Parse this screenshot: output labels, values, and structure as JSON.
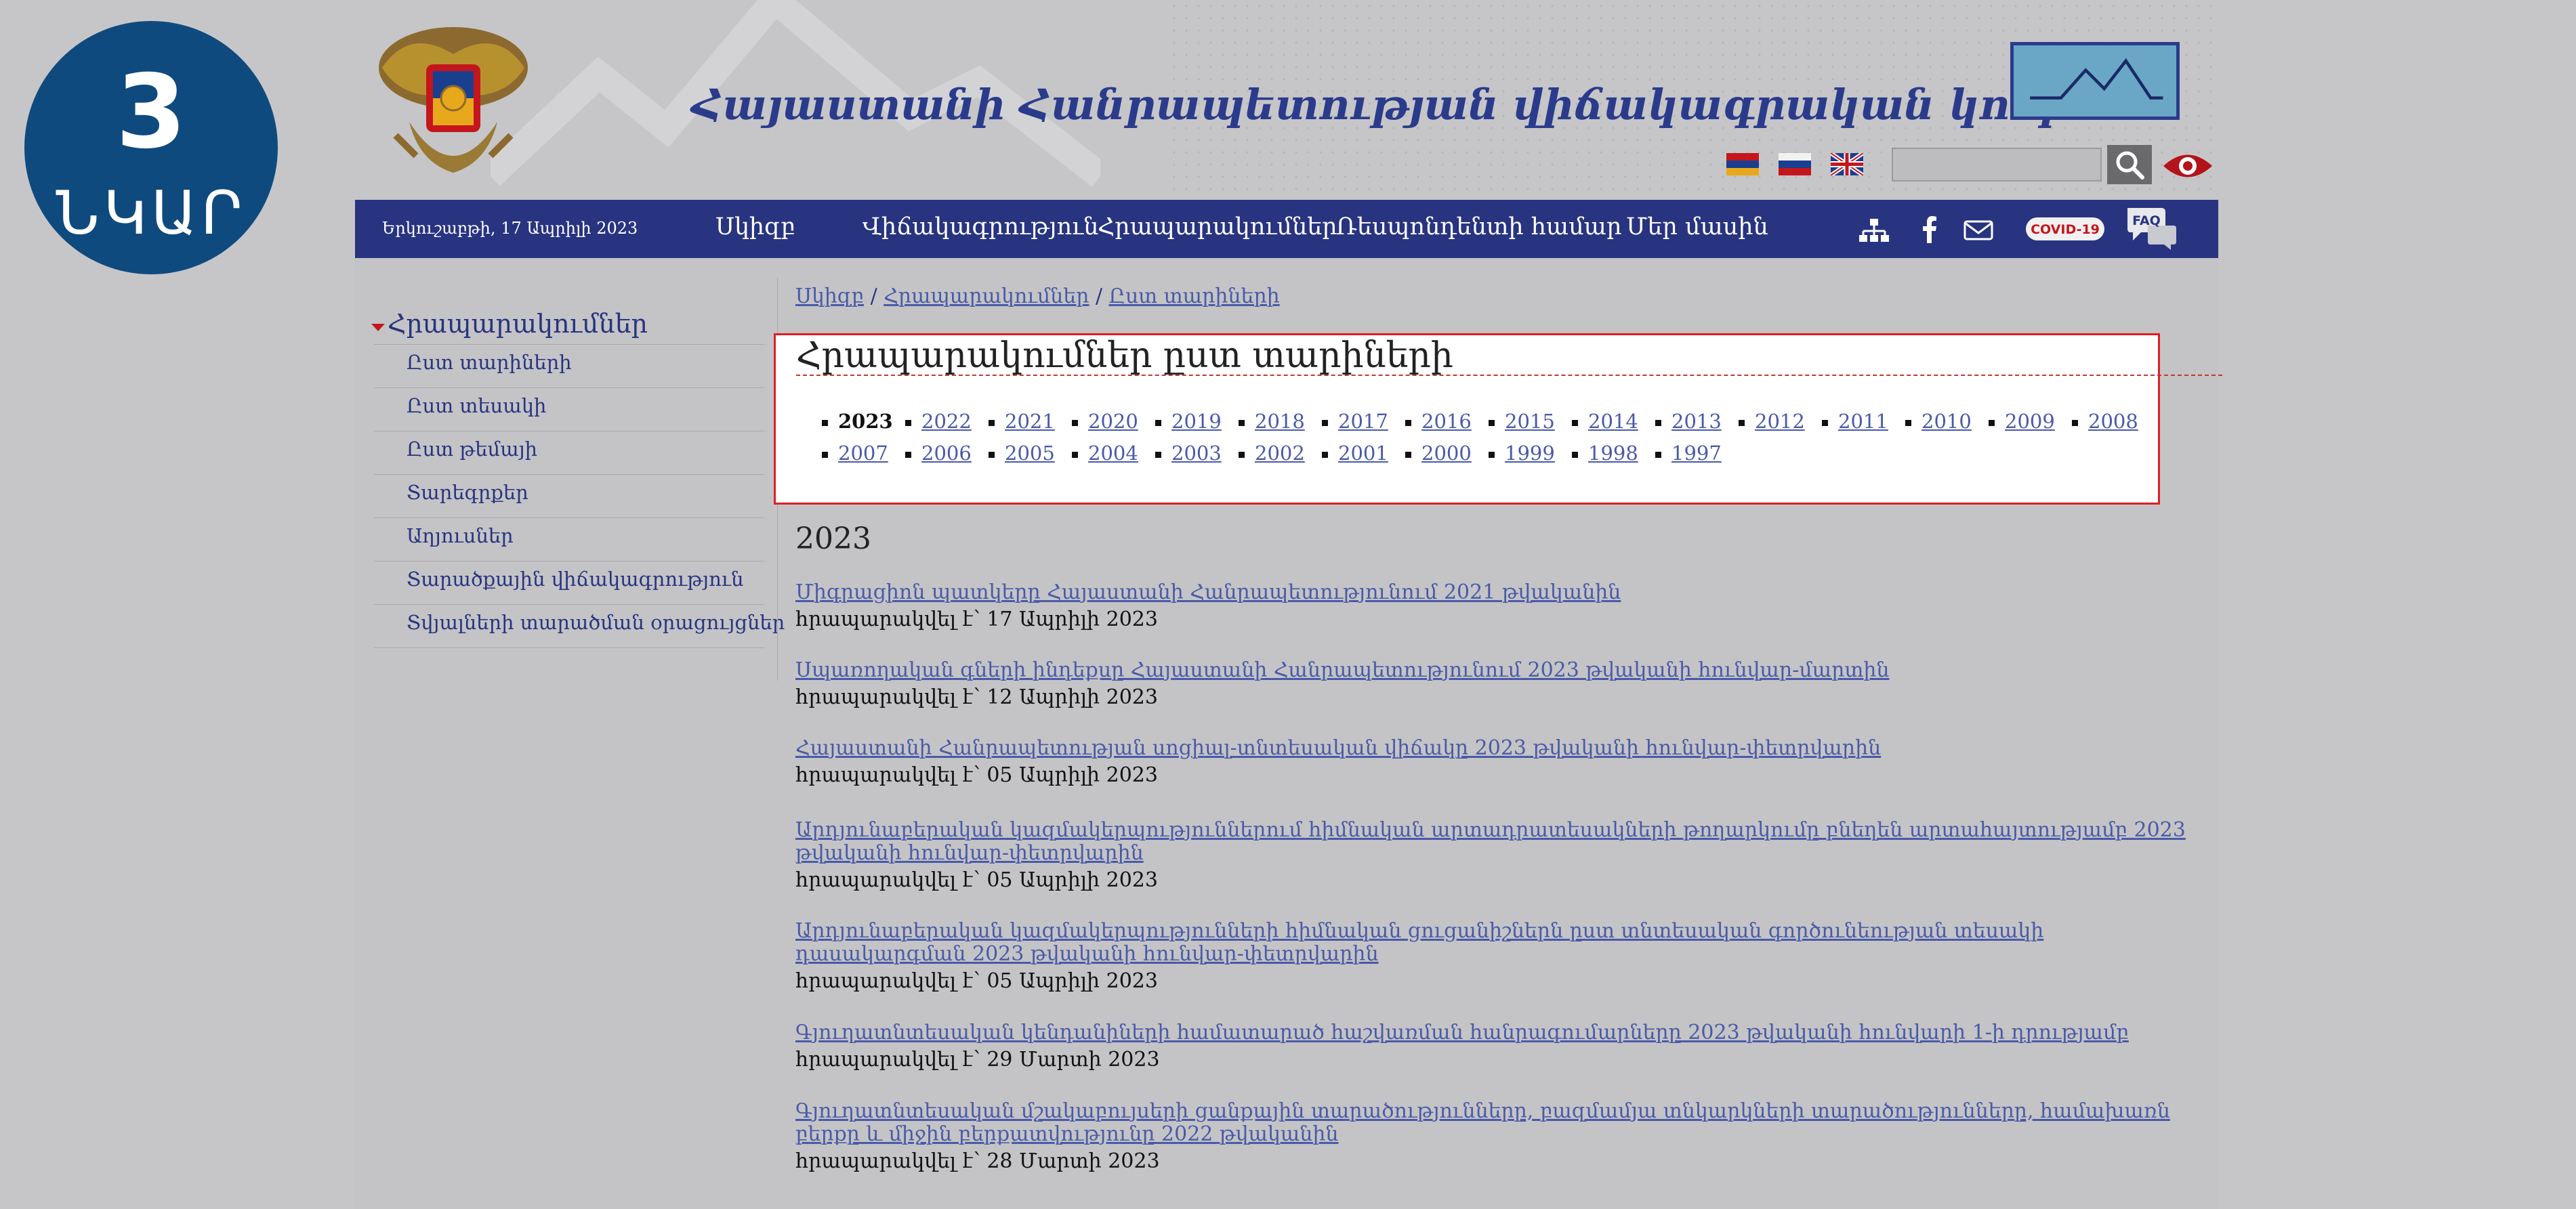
{
  "figure_badge": {
    "number": "3",
    "word": "ՆԿԱՐ"
  },
  "header": {
    "site_title": "Հայաստանի Հանրապետության վիճակագրական կոմիտե"
  },
  "navbar": {
    "date": "Երկուշաբթի, 17 Ապրիլի 2023",
    "items": [
      "Սկիզբ",
      "Վիճակագրություն",
      "Հրապարակումներ",
      "Ռեսպոնդենտի համար",
      "Մեր մասին"
    ],
    "covid_label": "COVID-19",
    "faq_label": "FAQ"
  },
  "sidebar": {
    "title": "Հրապարակումներ",
    "items": [
      "Ըստ տարիների",
      "Ըստ տեսակի",
      "Ըստ թեմայի",
      "Տարեգրքեր",
      "Աղյուսներ",
      "Տարածքային վիճակագրություն",
      "Տվյալների տարածման օրացույցներ"
    ]
  },
  "breadcrumb": [
    "Սկիզբ",
    "Հրապարակումներ",
    "Ըստ տարիների"
  ],
  "years_box": {
    "title": "Հրապարակումներ ըստ տարիների",
    "current_year": "2023",
    "row1": [
      "2023",
      "2022",
      "2021",
      "2020",
      "2019",
      "2018",
      "2017",
      "2016",
      "2015",
      "2014",
      "2013",
      "2012",
      "2011",
      "2010",
      "2009",
      "2008"
    ],
    "row2": [
      "2007",
      "2006",
      "2005",
      "2004",
      "2003",
      "2002",
      "2001",
      "2000",
      "1999",
      "1998",
      "1997"
    ]
  },
  "section_year": "2023",
  "publications": [
    {
      "title": "Միգրացիոն պատկերը Հայաստանի Հանրապետությունում 2021 թվականին",
      "date": "հրապարակվել է՝ 17 Ապրիլի 2023"
    },
    {
      "title": "Սպառողական գների ինդեքսը Հայաստանի Հանրապետությունում 2023 թվականի հունվար-մարտին",
      "date": "հրապարակվել է՝ 12 Ապրիլի 2023"
    },
    {
      "title": "Հայաստանի Հանրապետության սոցիալ-տնտեսական վիճակը 2023 թվականի հունվար-փետրվարին",
      "date": "հրապարակվել է՝ 05 Ապրիլի 2023"
    },
    {
      "title": "Արդյունաբերական կազմակերպություններում հիմնական արտադրատեսակների թողարկումը բնեղեն արտահայտությամբ 2023 թվականի հունվար-փետրվարին",
      "date": "հրապարակվել է՝ 05 Ապրիլի 2023"
    },
    {
      "title": "Արդյունաբերական կազմակերպությունների հիմնական ցուցանիշներն ըստ տնտեսական գործունեության տեսակի դասակարգման 2023 թվականի հունվար-փետրվարին",
      "date": "հրապարակվել է՝ 05 Ապրիլի 2023"
    },
    {
      "title": "Գյուղատնտեսական կենդանիների համատարած հաշվառման հանրագումարները 2023 թվականի հունվարի 1-ի դրությամբ",
      "date": "հրապարակվել է՝ 29 Մարտի 2023"
    },
    {
      "title": "Գյուղատնտեսական մշակաբույսերի ցանքային տարածությունները, բազմամյա տնկարկների տարածությունները, համախառն բերքը և միջին բերքատվությունը 2022 թվականին",
      "date": "հրապարակվել է՝ 28 Մարտի 2023"
    }
  ],
  "colors": {
    "nav_bg": "#283480",
    "link": "#4a5aa8",
    "highlight_border": "#e31e24",
    "badge_bg": "#0f4a7e"
  }
}
